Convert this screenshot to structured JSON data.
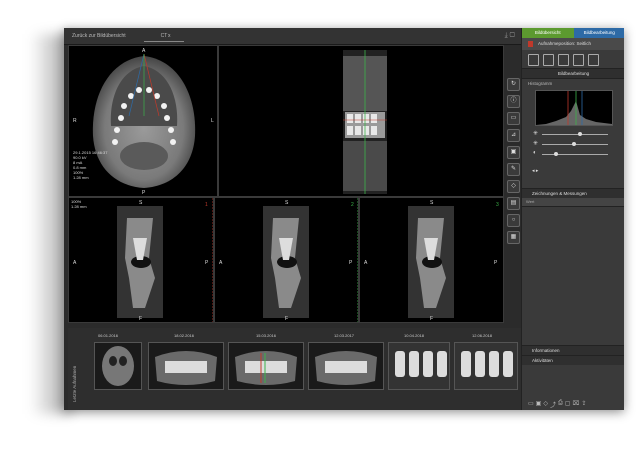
{
  "topbar": {
    "back_label": "Zurück zur Bildübersicht",
    "tab_label": "CT",
    "close_label": "x"
  },
  "axial": {
    "orientation": {
      "a": "A",
      "r": "R",
      "l": "L",
      "p": "P"
    },
    "info": "29.1.2015 16:46:37\n90.0 kV\n8 mA\n0.8 mm\n100%\n1.28 mm"
  },
  "crosssections": [
    {
      "a": "A",
      "p": "P",
      "s": "S",
      "f": "F",
      "num": "1"
    },
    {
      "a": "A",
      "p": "P",
      "s": "S",
      "f": "F",
      "num": "2"
    },
    {
      "a": "A",
      "p": "P",
      "s": "S",
      "f": "F",
      "num": "3"
    }
  ],
  "crosssection_info": "100%\n1.28 mm",
  "sidebar": {
    "tab_left": "Bildübersicht",
    "tab_right": "Bildbearbeitung",
    "header": "Aufnahmeposition: Seitlich",
    "section_title": "Bildbearbeitung",
    "histogram_label": "Histogramm",
    "collapse_1": "Zeichnungen & Messungen",
    "input_placeholder": "Wert",
    "collapse_2": "Informationen",
    "collapse_3": "Aktivitäten"
  },
  "strip": {
    "label": "Letzte Aufnahmen",
    "dates": [
      "06.01.2016",
      "18.02.2016",
      "15.03.2016",
      "12.03.2017",
      "10.04.2018",
      "12.06.2018"
    ]
  }
}
